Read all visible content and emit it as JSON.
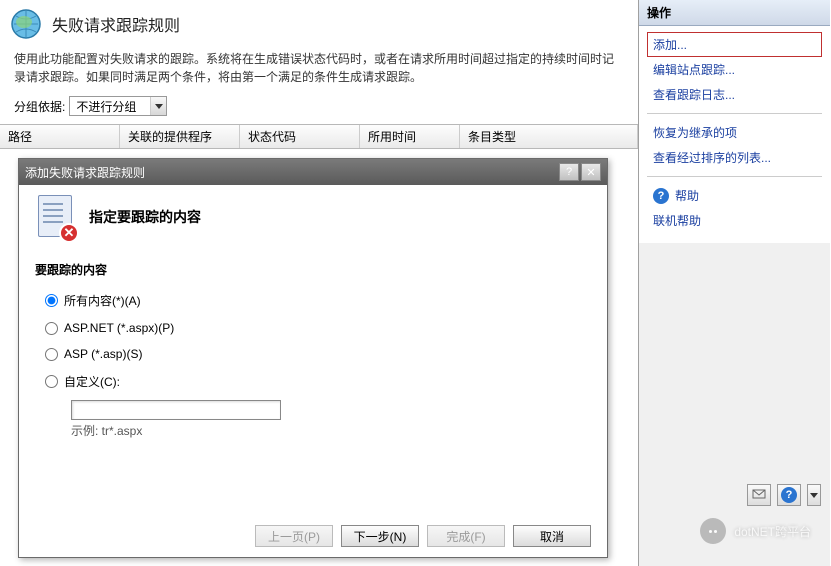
{
  "header": {
    "title": "失败请求跟踪规则",
    "description": "使用此功能配置对失败请求的跟踪。系统将在生成错误状态代码时，或者在请求所用时间超过指定的持续时间时记录请求跟踪。如果同时满足两个条件，将由第一个满足的条件生成请求跟踪。"
  },
  "group": {
    "label": "分组依据:",
    "selected": "不进行分组"
  },
  "columns": {
    "path": "路径",
    "provider": "关联的提供程序",
    "status": "状态代码",
    "time": "所用时间",
    "entry": "条目类型"
  },
  "dialog": {
    "title": "添加失败请求跟踪规则",
    "subtitle": "指定要跟踪的内容",
    "section": "要跟踪的内容",
    "options": {
      "all": "所有内容(*)(A)",
      "aspnet": "ASP.NET (*.aspx)(P)",
      "asp": "ASP (*.asp)(S)",
      "custom": "自定义(C):"
    },
    "example": "示例: tr*.aspx",
    "buttons": {
      "prev": "上一页(P)",
      "next": "下一步(N)",
      "finish": "完成(F)",
      "cancel": "取消"
    }
  },
  "actions": {
    "title": "操作",
    "add": "添加...",
    "editTrace": "编辑站点跟踪...",
    "viewLog": "查看跟踪日志...",
    "revert": "恢复为继承的项",
    "viewSorted": "查看经过排序的列表...",
    "help": "帮助",
    "onlineHelp": "联机帮助"
  },
  "watermark": "dotNET跨平台"
}
